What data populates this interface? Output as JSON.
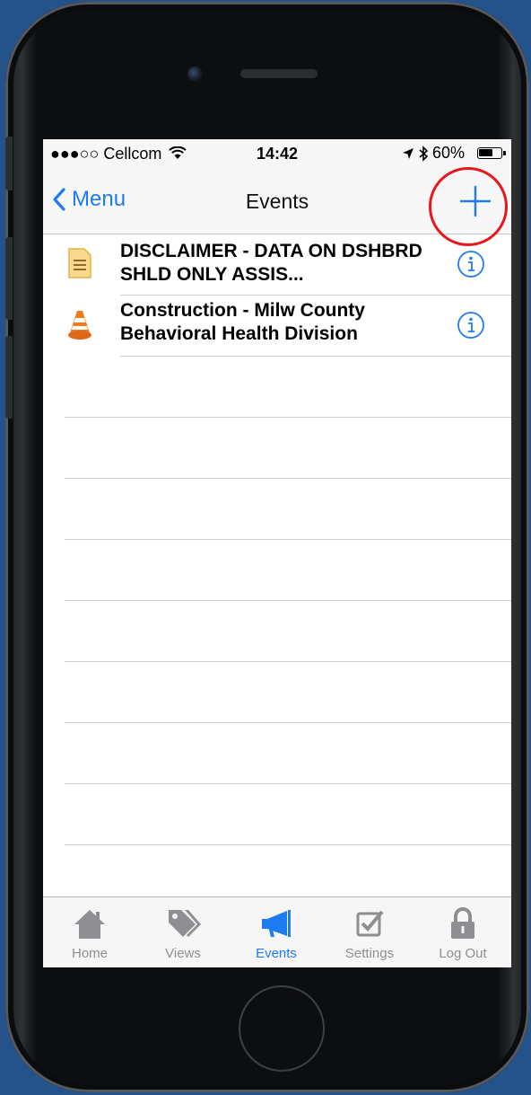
{
  "status_bar": {
    "carrier": "●●●○○ Cellcom",
    "time": "14:42",
    "battery": "60%"
  },
  "nav": {
    "back_label": "Menu",
    "title": "Events",
    "add_symbol": "+"
  },
  "events": [
    {
      "title": "DISCLAIMER - DATA ON DSHBRD SHLD ONLY ASSIS...",
      "icon": "document-icon"
    },
    {
      "title": "Construction - Milw County Behavioral Health Division",
      "icon": "traffic-cone-icon"
    }
  ],
  "tabs": [
    {
      "label": "Home",
      "icon": "home-icon",
      "active": false
    },
    {
      "label": "Views",
      "icon": "tags-icon",
      "active": false
    },
    {
      "label": "Events",
      "icon": "megaphone-icon",
      "active": true
    },
    {
      "label": "Settings",
      "icon": "checkbox-icon",
      "active": false
    },
    {
      "label": "Log Out",
      "icon": "lock-icon",
      "active": false
    }
  ],
  "colors": {
    "accent": "#1e7cf2",
    "highlight": "#e8151b",
    "background": "#24528b"
  }
}
